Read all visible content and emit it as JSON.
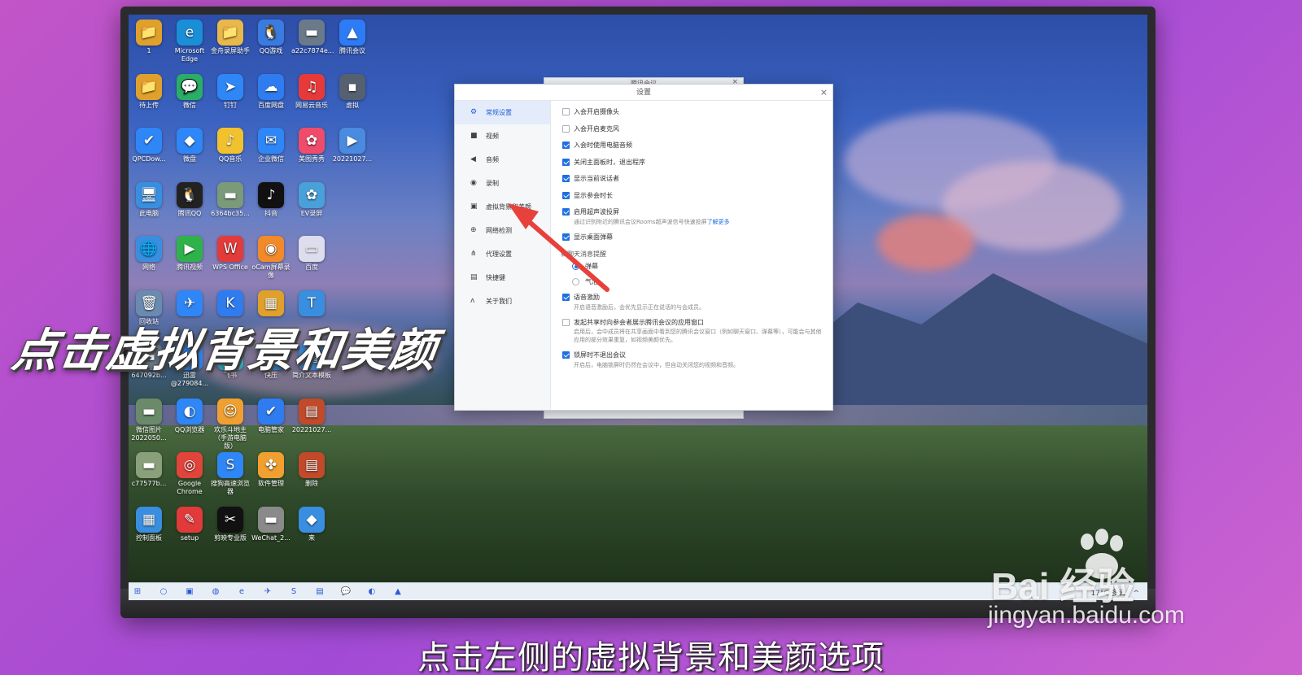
{
  "desktop_icons": [
    {
      "label": "1",
      "glyph": "📁",
      "color": "#e0a12c",
      "col": 0,
      "row": 0
    },
    {
      "label": "Microsoft Edge",
      "glyph": "e",
      "color": "#1a8fd8",
      "col": 1,
      "row": 0
    },
    {
      "label": "金舟录屏助手",
      "glyph": "📁",
      "color": "#e8b84a",
      "col": 2,
      "row": 0
    },
    {
      "label": "QQ游戏",
      "glyph": "🐧",
      "color": "#3a7be0",
      "col": 3,
      "row": 0
    },
    {
      "label": "a22c7874e...",
      "glyph": "▬",
      "color": "#6a7a8a",
      "col": 4,
      "row": 0
    },
    {
      "label": "腾讯会议",
      "glyph": "▲",
      "color": "#2d7cf6",
      "col": 5,
      "row": 0
    },
    {
      "label": "待上传",
      "glyph": "📁",
      "color": "#e0a12c",
      "col": 0,
      "row": 1
    },
    {
      "label": "微信",
      "glyph": "💬",
      "color": "#2aae67",
      "col": 1,
      "row": 1
    },
    {
      "label": "钉钉",
      "glyph": "➤",
      "color": "#2f86f6",
      "col": 2,
      "row": 1
    },
    {
      "label": "百度网盘",
      "glyph": "☁",
      "color": "#2f7cf0",
      "col": 3,
      "row": 1
    },
    {
      "label": "网易云音乐",
      "glyph": "♫",
      "color": "#e63a3a",
      "col": 4,
      "row": 1
    },
    {
      "label": "虚拟",
      "glyph": "▪",
      "color": "#556070",
      "col": 5,
      "row": 1
    },
    {
      "label": "QPCDow...",
      "glyph": "✔",
      "color": "#2f86f6",
      "col": 0,
      "row": 2
    },
    {
      "label": "微盘",
      "glyph": "◆",
      "color": "#2f86f6",
      "col": 1,
      "row": 2
    },
    {
      "label": "QQ音乐",
      "glyph": "♪",
      "color": "#f2c12e",
      "col": 2,
      "row": 2
    },
    {
      "label": "企业微信",
      "glyph": "✉",
      "color": "#2f86f6",
      "col": 3,
      "row": 2
    },
    {
      "label": "美图秀秀",
      "glyph": "✿",
      "color": "#ee4c6a",
      "col": 4,
      "row": 2
    },
    {
      "label": "20221027...",
      "glyph": "▶",
      "color": "#4a8adf",
      "col": 5,
      "row": 2
    },
    {
      "label": "此电脑",
      "glyph": "🖥",
      "color": "#3a8ee0",
      "col": 0,
      "row": 3
    },
    {
      "label": "腾讯QQ",
      "glyph": "🐧",
      "color": "#222",
      "col": 1,
      "row": 3
    },
    {
      "label": "6364bc35...",
      "glyph": "▬",
      "color": "#7a9a7a",
      "col": 2,
      "row": 3
    },
    {
      "label": "抖音",
      "glyph": "♪",
      "color": "#111",
      "col": 3,
      "row": 3
    },
    {
      "label": "EV录屏",
      "glyph": "✿",
      "color": "#4aa0d8",
      "col": 4,
      "row": 3
    },
    {
      "label": "网络",
      "glyph": "🌐",
      "color": "#3a8ee0",
      "col": 0,
      "row": 4
    },
    {
      "label": "腾讯视频",
      "glyph": "▶",
      "color": "#2fb24a",
      "col": 1,
      "row": 4
    },
    {
      "label": "WPS Office",
      "glyph": "W",
      "color": "#e33b3b",
      "col": 2,
      "row": 4
    },
    {
      "label": "oCam屏幕录像",
      "glyph": "◉",
      "color": "#f08a2a",
      "col": 3,
      "row": 4
    },
    {
      "label": "百度",
      "glyph": "▭",
      "color": "#dde",
      "col": 4,
      "row": 4
    },
    {
      "label": "回收站",
      "glyph": "🗑",
      "color": "#6a8ab0",
      "col": 0,
      "row": 5
    },
    {
      "label": "",
      "glyph": "✈",
      "color": "#2f86f6",
      "col": 1,
      "row": 5
    },
    {
      "label": "",
      "glyph": "K",
      "color": "#2f7cf0",
      "col": 2,
      "row": 5
    },
    {
      "label": "",
      "glyph": "▦",
      "color": "#e0a12c",
      "col": 3,
      "row": 5
    },
    {
      "label": "",
      "glyph": "T",
      "color": "#3a8ee0",
      "col": 4,
      "row": 5
    },
    {
      "label": "647092b...",
      "glyph": "▬",
      "color": "#6a7a8a",
      "col": 0,
      "row": 6
    },
    {
      "label": "迅雷 @279084...",
      "glyph": "⚡",
      "color": "#2f86f6",
      "col": 1,
      "row": 6
    },
    {
      "label": "飞书",
      "glyph": "✈",
      "color": "#2fb4c8",
      "col": 2,
      "row": 6
    },
    {
      "label": "快压",
      "glyph": "▣",
      "color": "#3a8ee0",
      "col": 3,
      "row": 6
    },
    {
      "label": "简介文本模板",
      "glyph": "▤",
      "color": "#3a8ee0",
      "col": 4,
      "row": 6
    },
    {
      "label": "微信图片 2022050...",
      "glyph": "▬",
      "color": "#6a8a6a",
      "col": 0,
      "row": 7
    },
    {
      "label": "QQ浏览器",
      "glyph": "◐",
      "color": "#2f86f6",
      "col": 1,
      "row": 7
    },
    {
      "label": "欢乐斗地主（手游电脑版）",
      "glyph": "☺",
      "color": "#f0a030",
      "col": 2,
      "row": 7
    },
    {
      "label": "电脑管家",
      "glyph": "✔",
      "color": "#2f7cf0",
      "col": 3,
      "row": 7
    },
    {
      "label": "20221027...",
      "glyph": "▤",
      "color": "#c04a2a",
      "col": 4,
      "row": 7
    },
    {
      "label": "c77577b...",
      "glyph": "▬",
      "color": "#8aa07a",
      "col": 0,
      "row": 8
    },
    {
      "label": "Google Chrome",
      "glyph": "◎",
      "color": "#e0443a",
      "col": 1,
      "row": 8
    },
    {
      "label": "搜狗高速浏览器",
      "glyph": "S",
      "color": "#2f86f6",
      "col": 2,
      "row": 8
    },
    {
      "label": "软件管理",
      "glyph": "✤",
      "color": "#f0a030",
      "col": 3,
      "row": 8
    },
    {
      "label": "删除",
      "glyph": "▤",
      "color": "#c04a2a",
      "col": 4,
      "row": 8
    },
    {
      "label": "控制面板",
      "glyph": "▦",
      "color": "#3a8ee0",
      "col": 0,
      "row": 9
    },
    {
      "label": "setup",
      "glyph": "✎",
      "color": "#e03a3a",
      "col": 1,
      "row": 9
    },
    {
      "label": "剪映专业版",
      "glyph": "✂",
      "color": "#111",
      "col": 2,
      "row": 9
    },
    {
      "label": "WeChat_2...",
      "glyph": "▬",
      "color": "#8a8a8a",
      "col": 3,
      "row": 9
    },
    {
      "label": "来",
      "glyph": "◆",
      "color": "#3a8ee0",
      "col": 4,
      "row": 9
    }
  ],
  "taskbar": {
    "items": [
      "⊞",
      "○",
      "▣",
      "◍",
      "e",
      "✈",
      "S",
      "▤",
      "💬",
      "◐",
      "▲"
    ],
    "weather": "17°C 多云",
    "tray": "^"
  },
  "bg_window": {
    "title": "腾讯会议",
    "close": "×"
  },
  "dialog": {
    "title": "设置",
    "close": "×",
    "nav": [
      {
        "label": "常规设置",
        "icon": "⚙",
        "active": true,
        "name": "nav-general"
      },
      {
        "label": "视频",
        "icon": "■",
        "active": false,
        "name": "nav-video"
      },
      {
        "label": "音频",
        "icon": "◀",
        "active": false,
        "name": "nav-audio"
      },
      {
        "label": "录制",
        "icon": "◉",
        "active": false,
        "name": "nav-record"
      },
      {
        "label": "虚拟背景和美颜",
        "icon": "▣",
        "active": false,
        "name": "nav-virtual-background"
      },
      {
        "label": "网络检测",
        "icon": "⊕",
        "active": false,
        "name": "nav-network"
      },
      {
        "label": "代理设置",
        "icon": "⋔",
        "active": false,
        "name": "nav-proxy"
      },
      {
        "label": "快捷键",
        "icon": "▤",
        "active": false,
        "name": "nav-shortcuts"
      },
      {
        "label": "关于我们",
        "icon": "ᴧ",
        "active": false,
        "name": "nav-about"
      }
    ],
    "options": [
      {
        "label": "入会开启摄像头",
        "checked": false
      },
      {
        "label": "入会开启麦克风",
        "checked": false
      },
      {
        "label": "入会时使用电脑音频",
        "checked": true
      },
      {
        "label": "关闭主面板时，退出程序",
        "checked": true
      },
      {
        "label": "显示当前说话者",
        "checked": true
      },
      {
        "label": "显示参会时长",
        "checked": true
      },
      {
        "label": "启用超声波投屏",
        "checked": true,
        "sub": "通过识别附近的腾讯会议Rooms超声波信号快速投屏",
        "sub_link": "了解更多"
      },
      {
        "label": "显示桌面弹幕",
        "checked": true
      }
    ],
    "chat_group": "新聊天消息提醒",
    "radios": [
      {
        "label": "弹幕",
        "checked": true
      },
      {
        "label": "气泡",
        "checked": false
      }
    ],
    "options2": [
      {
        "label": "语音激励",
        "checked": true,
        "sub": "开启语音激励后，会优先显示正在说话的与会成员。"
      },
      {
        "label": "发起共享时向参会者展示腾讯会议的应用窗口",
        "checked": false,
        "sub": "启用后，会中成员将在共享画面中看到您的腾讯会议窗口（例如聊天窗口、弹幕等），可能会与其他应用的部分效果重复，如视频美颜优先。"
      },
      {
        "label": "锁屏时不退出会议",
        "checked": true,
        "sub": "开启后，电脑锁屏时仍然在会议中，但自动关闭您的视频和音频。"
      }
    ]
  },
  "overlay": {
    "big_caption": "点击虚拟背景和美颜",
    "subtitle": "点击左侧的虚拟背景和美颜选项"
  },
  "watermark": {
    "logo": "Bai  经验",
    "site": "jingyan.baidu.com"
  },
  "colors": {
    "accent": "#1f6fe0",
    "arrow": "#e8403a"
  }
}
